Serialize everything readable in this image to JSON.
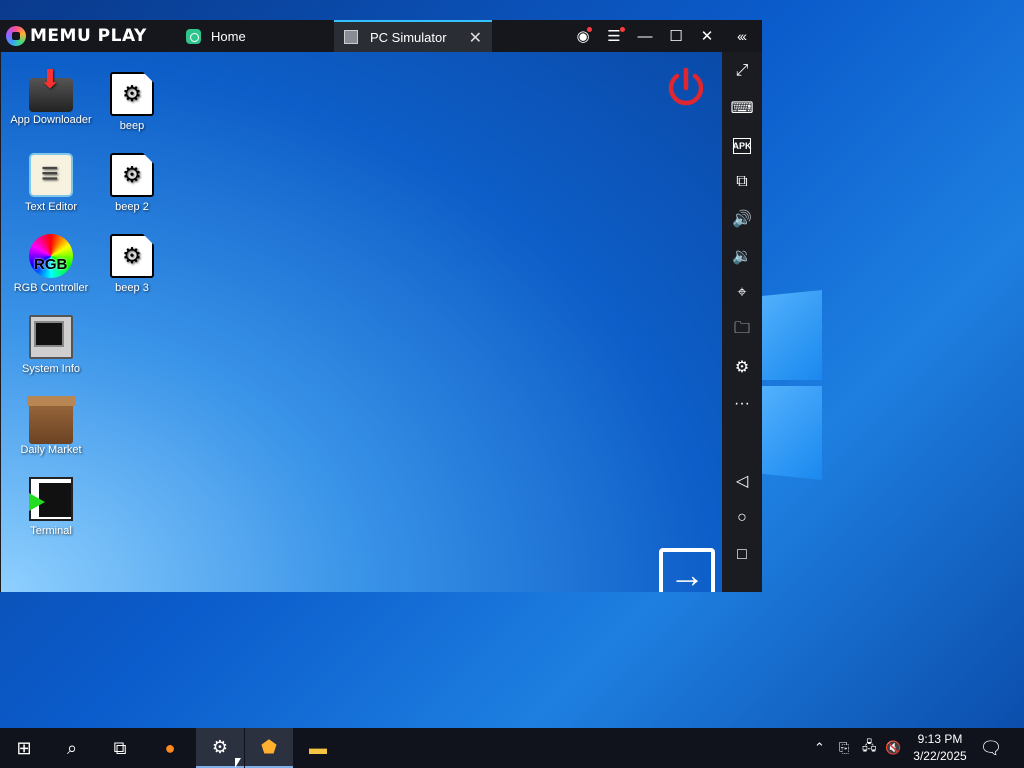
{
  "emulator": {
    "brand": "MEMU PLAY",
    "tabs": [
      {
        "label": "Home"
      },
      {
        "label": "PC Simulator"
      }
    ],
    "sidebar": [
      "fullscreen-icon",
      "keyboard-icon",
      "apk-icon",
      "multi-window-icon",
      "volume-up-icon",
      "volume-down-icon",
      "location-icon",
      "folder-icon",
      "settings-icon",
      "more-icon",
      "back-icon",
      "home-icon",
      "recents-icon"
    ],
    "apk_label": "APK"
  },
  "desktop_icons": [
    {
      "label": "App Downloader"
    },
    {
      "label": "beep"
    },
    {
      "label": "Text Editor"
    },
    {
      "label": "beep 2"
    },
    {
      "label": "RGB Controller"
    },
    {
      "label": "beep 3"
    },
    {
      "label": "System Info"
    },
    {
      "label": "Daily Market"
    },
    {
      "label": "Terminal"
    }
  ],
  "rgb_badge": "RGB",
  "taskbar": {
    "time": "9:13 PM",
    "date": "3/22/2025"
  },
  "colors": {
    "accent": "#35c0ff",
    "power": "#e0262e"
  }
}
